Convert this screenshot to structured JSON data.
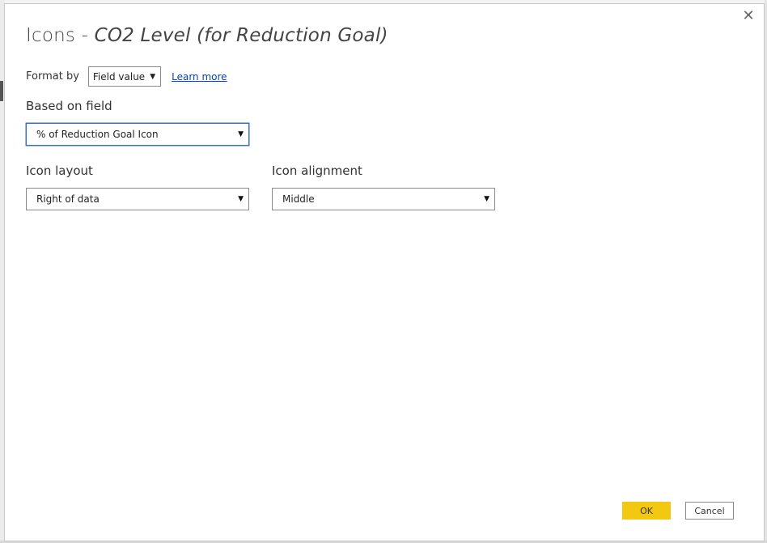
{
  "dialog": {
    "title_prefix": "Icons - ",
    "title_field": "CO2 Level (for Reduction Goal)",
    "close_glyph": "✕",
    "icon_names": {
      "close": "close-icon",
      "dropdown": "chevron-down-icon"
    }
  },
  "format_by": {
    "label": "Format by",
    "selected": "Field value",
    "learn_more": "Learn more"
  },
  "based_on_field": {
    "label": "Based on field",
    "selected": "% of Reduction Goal Icon"
  },
  "icon_layout": {
    "label": "Icon layout",
    "selected": "Right of data"
  },
  "icon_alignment": {
    "label": "Icon alignment",
    "selected": "Middle"
  },
  "buttons": {
    "ok": "OK",
    "cancel": "Cancel"
  },
  "colors": {
    "accent_ok": "#f2c811",
    "focus_border": "#3c6dc5",
    "link": "#0645ad"
  }
}
